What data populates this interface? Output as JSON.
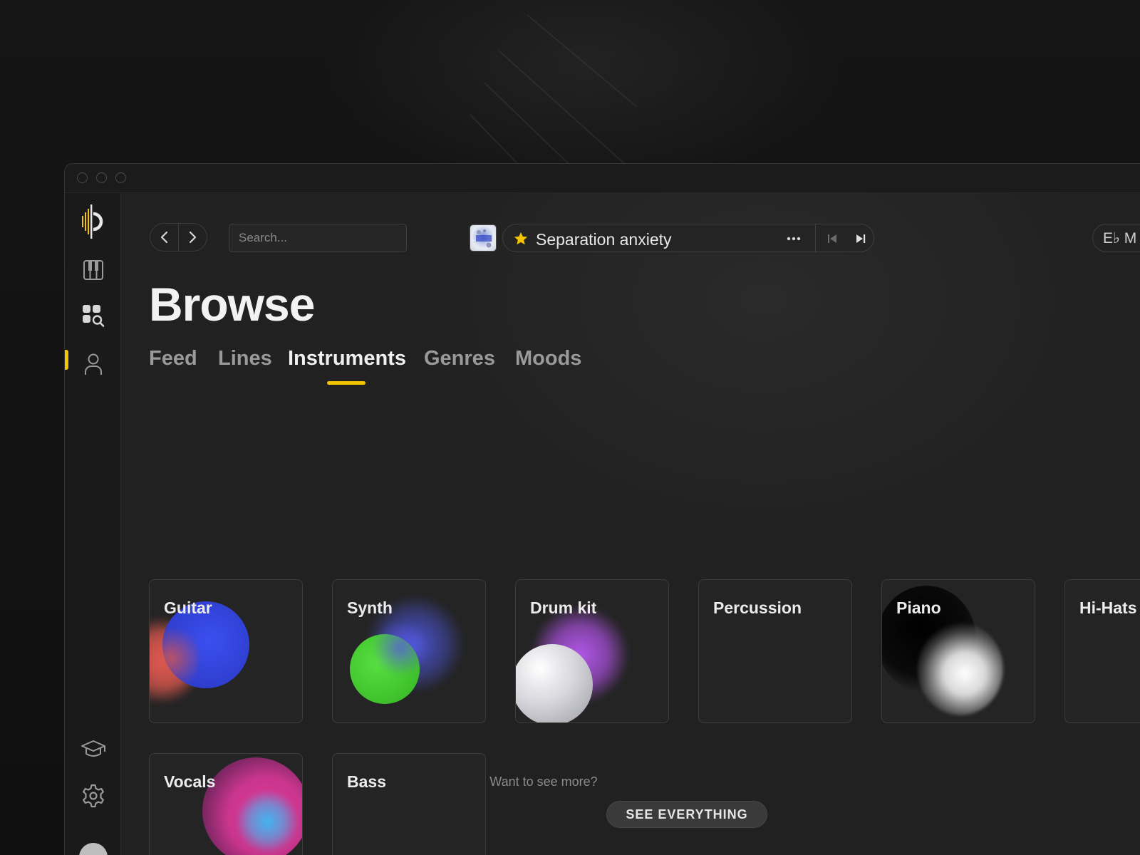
{
  "window": {
    "controls": [
      "close",
      "minimize",
      "maximize"
    ]
  },
  "sidebar": {
    "logo_icon": "app-logo-icon",
    "items": [
      {
        "name": "piano-keys-icon",
        "active": false
      },
      {
        "name": "browse-search-icon",
        "active": true
      },
      {
        "name": "user-profile-icon",
        "active": false
      }
    ],
    "bottom_items": [
      {
        "name": "graduation-cap-icon"
      },
      {
        "name": "gear-icon"
      },
      {
        "name": "avatar"
      }
    ],
    "accent_color": "#f5c400"
  },
  "toolbar": {
    "back_icon": "chevron-left-icon",
    "forward_icon": "chevron-right-icon",
    "search_placeholder": "Search...",
    "now_playing": {
      "title": "Separation anxiety",
      "starred": true,
      "star_color": "#f5c400"
    },
    "key_label": "E♭ M"
  },
  "page": {
    "title": "Browse",
    "tabs": [
      {
        "label": "Feed",
        "active": false
      },
      {
        "label": "Lines",
        "active": false
      },
      {
        "label": "Instruments",
        "active": true
      },
      {
        "label": "Genres",
        "active": false
      },
      {
        "label": "Moods",
        "active": false
      }
    ]
  },
  "instruments": [
    {
      "label": "Guitar"
    },
    {
      "label": "Synth"
    },
    {
      "label": "Drum kit"
    },
    {
      "label": "Percussion"
    },
    {
      "label": "Piano"
    },
    {
      "label": "Hi-Hats"
    },
    {
      "label": "Vocals"
    },
    {
      "label": "Bass"
    }
  ],
  "footer": {
    "prompt": "Want to see more?",
    "button_label": "SEE EVERYTHING"
  }
}
